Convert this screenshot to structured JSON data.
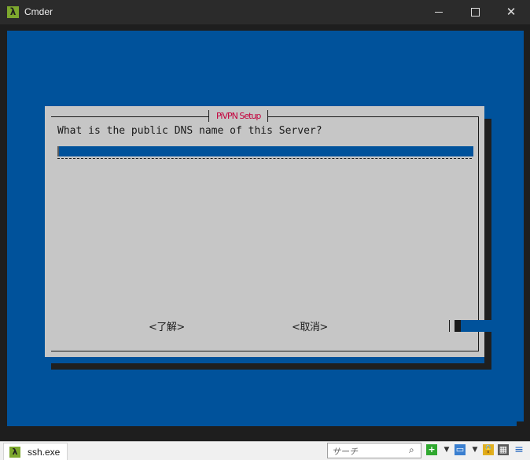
{
  "window": {
    "title": "Cmder",
    "logo_glyph": "λ",
    "minimize_glyph": "",
    "close_glyph": "✕"
  },
  "dialog": {
    "title": "PiVPN Setup",
    "prompt": "What is the public DNS name of this Server?",
    "input_value": "",
    "ok_label": "<了解>",
    "cancel_label": "<取消>"
  },
  "statusbar": {
    "tab_icon_glyph": "λ",
    "tab_label": "ssh.exe",
    "search_placeholder": "サーチ",
    "search_icon_glyph": "⌕",
    "plus_glyph": "+",
    "dropdown_glyph": "▼",
    "panel_glyph": "▭",
    "lock_glyph": "🔒",
    "grid_glyph": "▦",
    "menu_glyph": "≡"
  },
  "colors": {
    "terminal_bg": "#00529b",
    "dialog_bg": "#c6c6c6",
    "title_red": "#c4003c",
    "logo_green": "#7da82e"
  }
}
